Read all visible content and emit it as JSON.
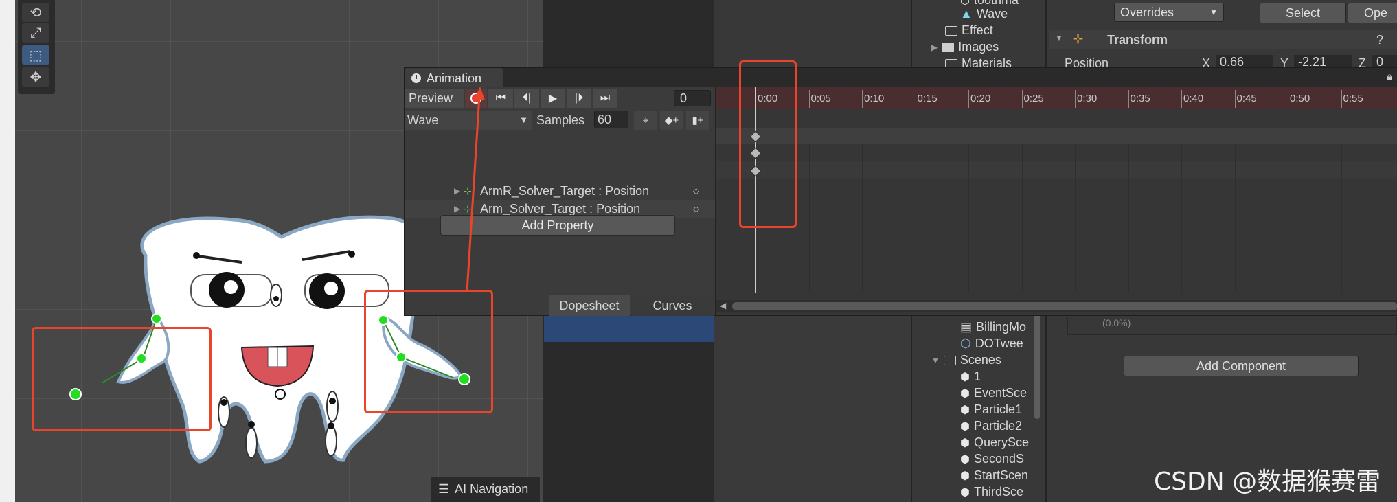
{
  "scene": {
    "tools": [
      "rotate-tool",
      "scale-tool",
      "rect-tool",
      "transform-tool"
    ],
    "ai_navigation_label": "AI Navigation"
  },
  "hierarchy": {
    "items": [
      {
        "label": "toothma",
        "type": "prefab"
      },
      {
        "label": "Wave",
        "type": "anim"
      },
      {
        "label": "Effect",
        "type": "folder"
      },
      {
        "label": "Images",
        "type": "folder"
      },
      {
        "label": "Materials",
        "type": "folder"
      },
      {
        "label": "BillingMo",
        "type": "script"
      },
      {
        "label": "DOTwee",
        "type": "asset"
      },
      {
        "label": "Scenes",
        "type": "folder-open"
      },
      {
        "label": "1",
        "type": "scene"
      },
      {
        "label": "EventSce",
        "type": "scene"
      },
      {
        "label": "Particle1",
        "type": "scene"
      },
      {
        "label": "Particle2",
        "type": "scene"
      },
      {
        "label": "QuerySce",
        "type": "scene"
      },
      {
        "label": "SecondS",
        "type": "scene"
      },
      {
        "label": "StartScen",
        "type": "scene"
      },
      {
        "label": "ThirdSce",
        "type": "scene"
      }
    ]
  },
  "inspector": {
    "overrides_label": "Overrides",
    "select_label": "Select",
    "open_label": "Ope",
    "transform_label": "Transform",
    "position_label": "Position",
    "pos_x_label": "X",
    "pos_x": "0.66",
    "pos_y_label": "Y",
    "pos_y": "-2.21",
    "pos_z_label": "Z",
    "pos_z": "0",
    "hidden_value": "(0.0%)",
    "add_component_label": "Add Component"
  },
  "animation": {
    "tab_label": "Animation",
    "preview_label": "Preview",
    "frame_value": "0",
    "clip_name": "Wave",
    "samples_label": "Samples",
    "samples_value": "60",
    "properties": [
      "ArmR_Solver_Target : Position",
      "Arm_Solver_Target : Position"
    ],
    "add_property_label": "Add Property",
    "dopesheet_label": "Dopesheet",
    "curves_label": "Curves",
    "ruler_ticks": [
      "0:00",
      "0:05",
      "0:10",
      "0:15",
      "0:20",
      "0:25",
      "0:30",
      "0:35",
      "0:40",
      "0:45",
      "0:50",
      "0:55"
    ]
  },
  "colors": {
    "annotation_red": "#e8452a",
    "record_red": "#ee3a3a",
    "joint_green": "#22dd22"
  },
  "watermark": "CSDN @数据猴赛雷"
}
